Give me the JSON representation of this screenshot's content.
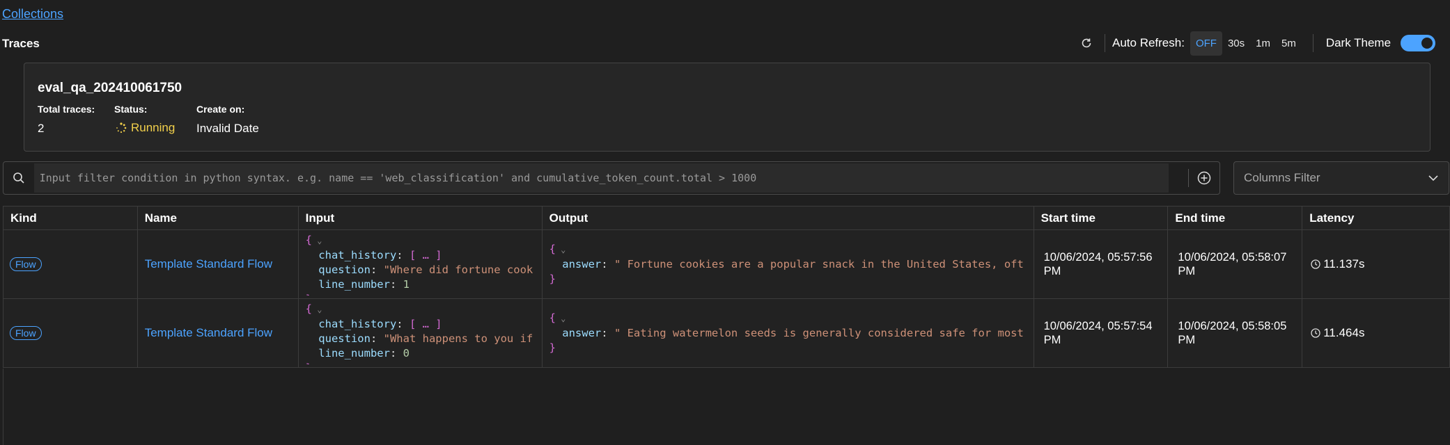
{
  "nav": {
    "collections_link": "Collections",
    "page_title": "Traces"
  },
  "toolbar": {
    "auto_refresh_label": "Auto Refresh:",
    "refresh_options": [
      "OFF",
      "30s",
      "1m",
      "5m"
    ],
    "active_option": "OFF",
    "dark_theme_label": "Dark Theme",
    "dark_theme_on": true
  },
  "summary": {
    "name": "eval_qa_202410061750",
    "total_traces_label": "Total traces:",
    "total_traces_value": "2",
    "status_label": "Status:",
    "status_value": "Running",
    "create_on_label": "Create on:",
    "create_on_value": "Invalid Date"
  },
  "filter": {
    "placeholder": "Input filter condition in python syntax. e.g. name == 'web_classification' and cumulative_token_count.total > 1000",
    "columns_filter_label": "Columns Filter"
  },
  "table": {
    "headers": [
      "Kind",
      "Name",
      "Input",
      "Output",
      "Start time",
      "End time",
      "Latency"
    ],
    "rows": [
      {
        "kind": "Flow",
        "name": "Template Standard Flow",
        "input": {
          "chat_history": "[ … ]",
          "question": "\"Where did fortune cook",
          "line_number": "1"
        },
        "output": {
          "answer": "\" Fortune cookies are a popular snack in the United States, oft"
        },
        "start_time": "10/06/2024, 05:57:56 PM",
        "end_time": "10/06/2024, 05:58:07 PM",
        "latency": "11.137s"
      },
      {
        "kind": "Flow",
        "name": "Template Standard Flow",
        "input": {
          "chat_history": "[ … ]",
          "question": "\"What happens to you if",
          "line_number": "0"
        },
        "output": {
          "answer": "\" Eating watermelon seeds is generally considered safe for most"
        },
        "start_time": "10/06/2024, 05:57:54 PM",
        "end_time": "10/06/2024, 05:58:05 PM",
        "latency": "11.464s"
      }
    ]
  },
  "colors": {
    "accent": "#4ca3ff",
    "running": "#f2d04b",
    "background": "#1f1f1f"
  }
}
